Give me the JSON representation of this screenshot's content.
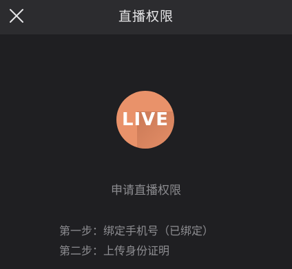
{
  "nav": {
    "title": "直播权限",
    "close_icon": "close-icon"
  },
  "badge": {
    "text": "LIVE",
    "color": "#e9926a"
  },
  "main": {
    "apply_title": "申请直播权限",
    "steps": [
      "第一步：绑定手机号（已绑定）",
      "第二步：上传身份证明"
    ]
  }
}
